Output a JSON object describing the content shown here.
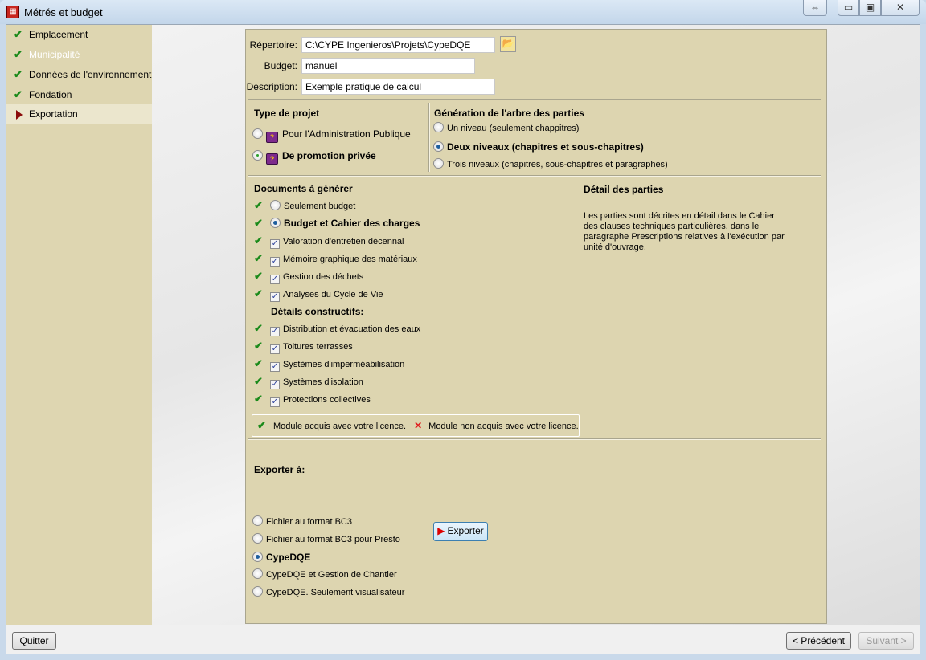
{
  "window": {
    "title": "Métrés et budget",
    "icon": "cype-app-icon",
    "controls": [
      "resize-arrows-icon",
      "minimize-icon",
      "maximize-icon",
      "close-icon"
    ]
  },
  "sidebar": {
    "items": [
      {
        "label": "Emplacement",
        "state": "done"
      },
      {
        "label": "Municipalité",
        "state": "disabled"
      },
      {
        "label": "Données de l'environnement",
        "state": "done"
      },
      {
        "label": "Fondation",
        "state": "done"
      },
      {
        "label": "Exportation",
        "state": "current"
      }
    ]
  },
  "form": {
    "repertoire_label": "Répertoire:",
    "repertoire_value": "C:\\CYPE Ingenieros\\Projets\\CypeDQE",
    "budget_label": "Budget:",
    "budget_value": "manuel",
    "description_label": "Description:",
    "description_value": "Exemple pratique de calcul"
  },
  "type_projet": {
    "title": "Type de projet",
    "options": [
      {
        "label": "Pour l'Administration Publique",
        "selected": false
      },
      {
        "label": "De promotion privée",
        "selected": true
      }
    ]
  },
  "generation": {
    "title": "Génération de l'arbre des parties",
    "options": [
      {
        "label": "Un niveau (seulement chappitres)",
        "selected": false
      },
      {
        "label": "Deux niveaux (chapitres et sous-chapitres)",
        "selected": true
      },
      {
        "label": "Trois niveaux (chapitres, sous-chapitres et paragraphes)",
        "selected": false
      }
    ]
  },
  "documents": {
    "title": "Documents à générer",
    "radios": [
      {
        "label": "Seulement budget",
        "selected": false
      },
      {
        "label": "Budget et Cahier des charges",
        "selected": true
      }
    ],
    "checks": [
      {
        "label": "Valoration d'entretien décennal",
        "checked": true
      },
      {
        "label": "Mémoire graphique des matériaux",
        "checked": true
      },
      {
        "label": "Gestion des déchets",
        "checked": true
      },
      {
        "label": "Analyses du Cycle de Vie",
        "checked": true
      }
    ],
    "details_title": "Détails constructifs:",
    "details": [
      {
        "label": "Distribution et évacuation des eaux",
        "checked": true
      },
      {
        "label": "Toitures terrasses",
        "checked": true
      },
      {
        "label": "Systèmes d'imperméabilisation",
        "checked": true
      },
      {
        "label": "Systèmes d'isolation",
        "checked": true
      },
      {
        "label": "Protections collectives",
        "checked": true
      }
    ]
  },
  "detail_parties": {
    "title": "Détail des parties",
    "text": "Les parties sont décrites en détail dans le Cahier des clauses techniques particulières, dans le paragraphe Prescriptions relatives à l'exécution par unité d'ouvrage."
  },
  "legend": {
    "acquired": "Module acquis avec votre licence.",
    "not_acquired": "Module non acquis avec votre licence.",
    "acquired_color": "#1a8a1a",
    "not_acquired_color": "#e02020"
  },
  "export": {
    "title": "Exporter à:",
    "options": [
      {
        "label": "Fichier au format BC3",
        "selected": false
      },
      {
        "label": "Fichier au format BC3 pour Presto",
        "selected": false
      },
      {
        "label": "CypeDQE",
        "selected": true
      },
      {
        "label": "CypeDQE et Gestion de Chantier",
        "selected": false
      },
      {
        "label": "CypeDQE. Seulement visualisateur",
        "selected": false
      }
    ],
    "button": "Exporter"
  },
  "footer": {
    "quit": "Quitter",
    "previous": "< Précédent",
    "next": "Suivant >"
  }
}
